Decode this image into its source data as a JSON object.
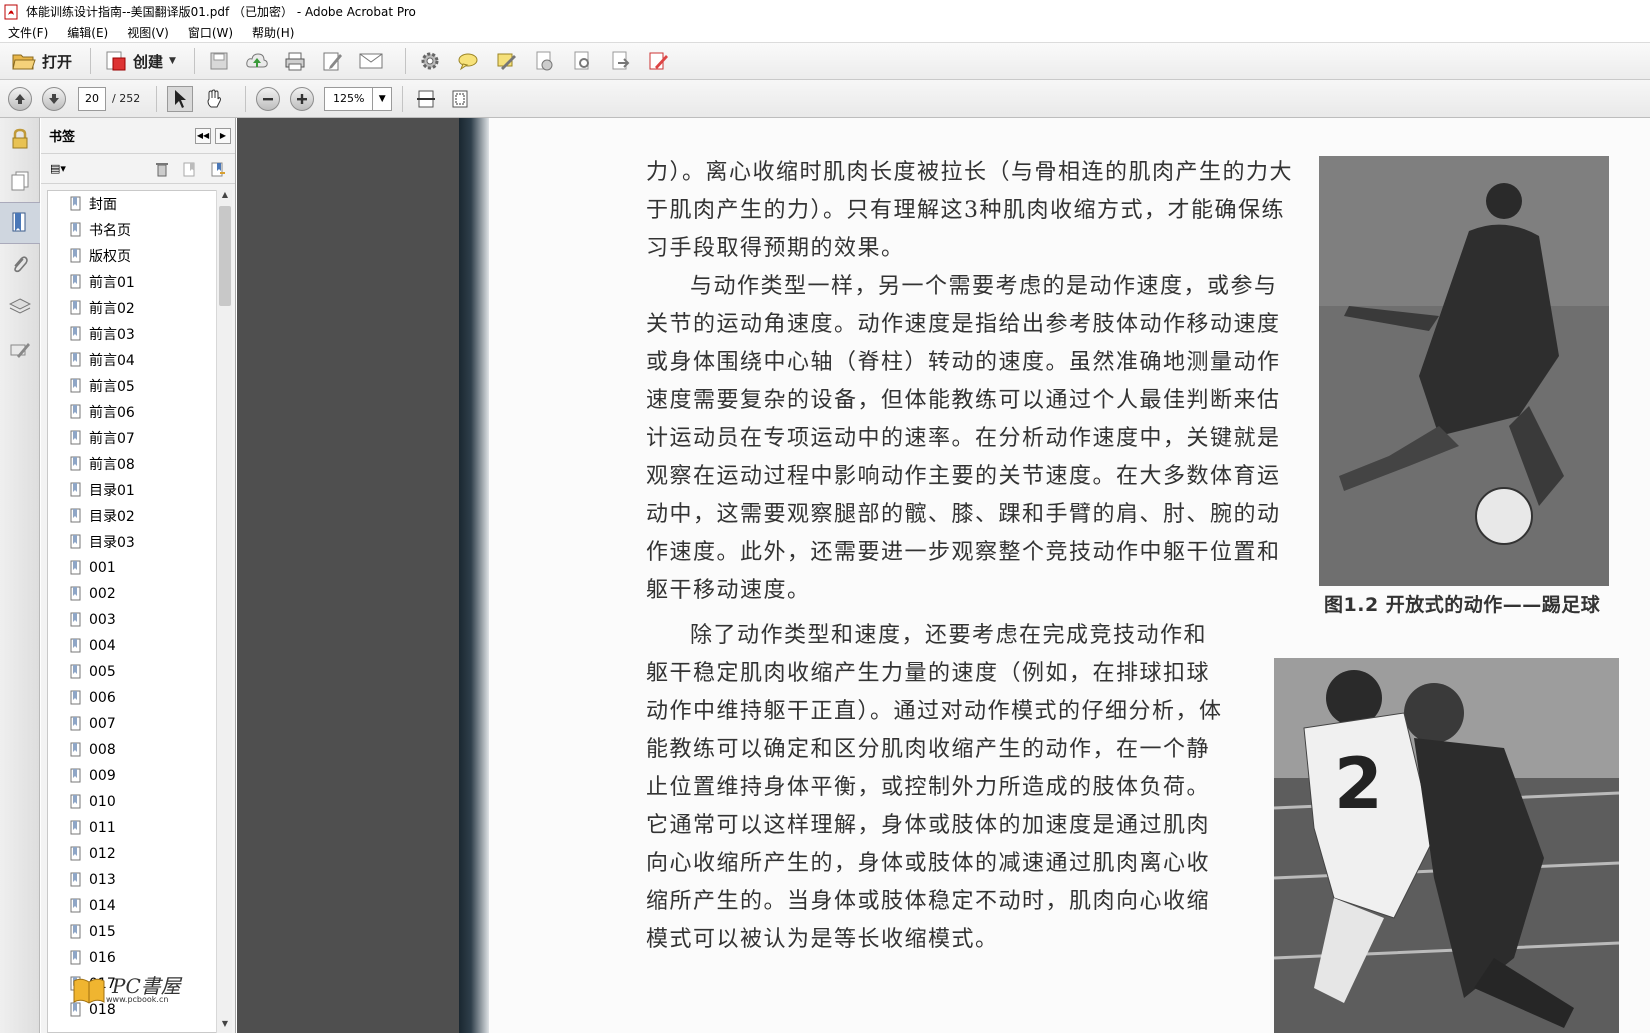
{
  "window": {
    "title": "体能训练设计指南--美国翻译版01.pdf （已加密） - Adobe Acrobat Pro"
  },
  "menu": [
    "文件(F)",
    "编辑(E)",
    "视图(V)",
    "窗口(W)",
    "帮助(H)"
  ],
  "toolbar": {
    "open_label": "打开",
    "create_label": "创建"
  },
  "nav": {
    "current_page": "20",
    "total_pages": "/ 252",
    "zoom": "125%"
  },
  "bookmarks": {
    "title": "书签",
    "items": [
      "封面",
      "书名页",
      "版权页",
      "前言01",
      "前言02",
      "前言03",
      "前言04",
      "前言05",
      "前言06",
      "前言07",
      "前言08",
      "目录01",
      "目录02",
      "目录03",
      "001",
      "002",
      "003",
      "004",
      "005",
      "006",
      "007",
      "008",
      "009",
      "010",
      "011",
      "012",
      "013",
      "014",
      "015",
      "016",
      "017",
      "018"
    ]
  },
  "watermark": {
    "name": "PC書屋",
    "url": "www.pcbook.cn"
  },
  "document": {
    "paragraph1": [
      "力）。离心收缩时肌肉长度被拉长（与骨相连的肌肉产生的力大于肌肉产生的力）。只有理解这3种肌肉收缩方式，才能确保练习手段取得预期的效果。",
      "与动作类型一样，另一个需要考虑的是动作速度，或参与关节的运动角速度。动作速度是指给出参考肢体动作移动速度或身体围绕中心轴（脊柱）转动的速度。虽然准确地测量动作速度需要复杂的设备，但体能教练可以通过个人最佳判断来估计运动员在专项运动中的速率。在分析动作速度中，关键就是观察在运动过程中影响动作主要的关节速度。在大多数体育运动中，这需要观察腿部的髋、膝、踝和手臂的肩、肘、腕的动作速度。此外，还需要进一步观察整个竞技动作中躯干位置和躯干移动速度。"
    ],
    "paragraph2": "除了动作类型和速度，还要考虑在完成竞技动作和躯干稳定肌肉收缩产生力量的速度（例如，在排球扣球动作中维持躯干正直）。通过对动作模式的仔细分析，体能教练可以确定和区分肌肉收缩产生的动作，在一个静止位置维持身体平衡，或控制外力所造成的肢体负荷。它通常可以这样理解，身体或肢体的加速度是通过肌肉向心收缩所产生的，身体或肢体的减速通过肌肉离心收缩所产生的。当身体或肢体稳定不动时，肌肉向心收缩模式可以被认为是等长收缩模式。",
    "figure_caption": "图1.2 开放式的动作——踢足球"
  }
}
